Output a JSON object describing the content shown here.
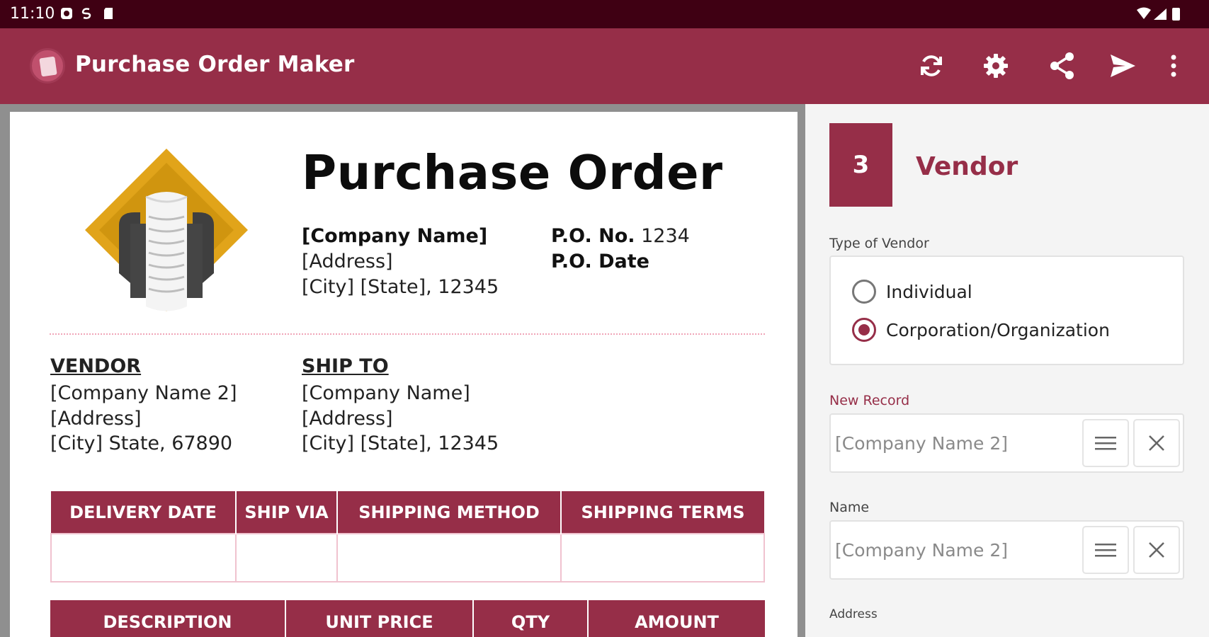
{
  "status_bar": {
    "time": "11:10"
  },
  "app_bar": {
    "title": "Purchase Order Maker",
    "actions": [
      "refresh-icon",
      "settings-icon",
      "share-icon",
      "send-icon",
      "more-icon"
    ]
  },
  "colors": {
    "primary": "#962e48",
    "status": "#3f0013",
    "accent_line": "#f0a5b8"
  },
  "document": {
    "title": "Purchase Order",
    "company": {
      "name": "[Company Name]",
      "address": "[Address]",
      "city_line": "[City] [State], 12345"
    },
    "po_number_label": "P.O. No.",
    "po_number_value": "1234",
    "po_date_label": "P.O. Date",
    "vendor": {
      "heading": "VENDOR",
      "name": "[Company Name 2]",
      "address": "[Address]",
      "city_line": "[City] State, 67890"
    },
    "ship_to": {
      "heading": "SHIP TO",
      "name": "[Company Name]",
      "address": "[Address]",
      "city_line": "[City] [State], 12345"
    },
    "shipping_table": {
      "headers": [
        "DELIVERY DATE",
        "SHIP VIA",
        "SHIPPING METHOD",
        "SHIPPING TERMS"
      ]
    },
    "items_table": {
      "headers": [
        "DESCRIPTION",
        "UNIT PRICE",
        "QTY",
        "AMOUNT"
      ]
    }
  },
  "panel": {
    "step_number": "3",
    "step_title": "Vendor",
    "type_label": "Type of Vendor",
    "options": [
      "Individual",
      "Corporation/Organization"
    ],
    "selected_option": "Corporation/Organization",
    "new_record_label": "New Record",
    "new_record_placeholder": "[Company Name 2]",
    "name_label": "Name",
    "name_placeholder": "[Company Name 2]",
    "address_label": "Address"
  }
}
